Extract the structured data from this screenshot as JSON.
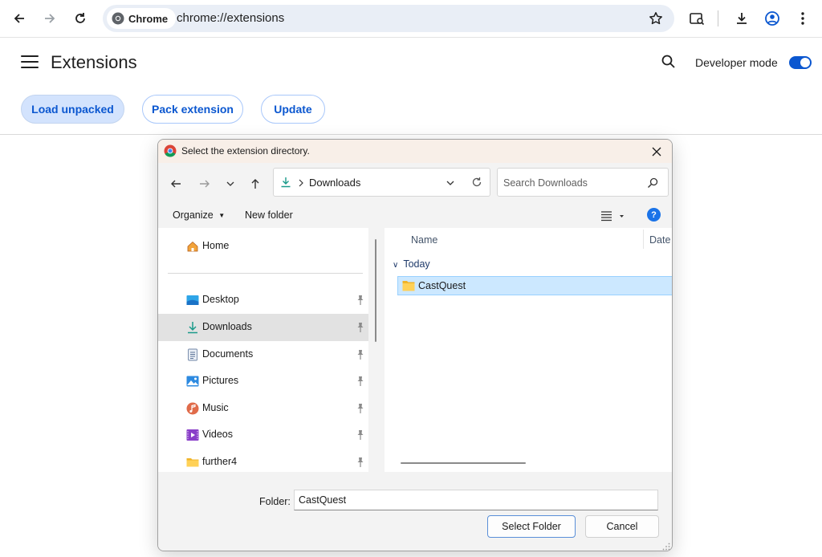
{
  "browser": {
    "omnibox_chip": "Chrome",
    "url": "chrome://extensions"
  },
  "extensions_page": {
    "title": "Extensions",
    "developer_mode_label": "Developer mode",
    "developer_mode_enabled": true,
    "buttons": {
      "load_unpacked": "Load unpacked",
      "pack_extension": "Pack extension",
      "update": "Update"
    }
  },
  "dialog": {
    "title": "Select the extension directory.",
    "address_path": "Downloads",
    "search_placeholder": "Search Downloads",
    "toolbar": {
      "organize": "Organize",
      "new_folder": "New folder"
    },
    "nav_pane": {
      "home": "Home",
      "items": [
        {
          "label": "Desktop",
          "icon": "desktop-icon"
        },
        {
          "label": "Downloads",
          "icon": "download-icon",
          "selected": true
        },
        {
          "label": "Documents",
          "icon": "documents-icon"
        },
        {
          "label": "Pictures",
          "icon": "pictures-icon"
        },
        {
          "label": "Music",
          "icon": "music-icon"
        },
        {
          "label": "Videos",
          "icon": "videos-icon"
        },
        {
          "label": "further4",
          "icon": "folder-icon"
        }
      ]
    },
    "file_list": {
      "columns": [
        "Name",
        "Date"
      ],
      "group": "Today",
      "items": [
        {
          "name": "CastQuest",
          "icon": "folder-icon",
          "selected": true
        }
      ]
    },
    "footer": {
      "folder_label": "Folder:",
      "folder_value": "CastQuest",
      "select_button": "Select Folder",
      "cancel_button": "Cancel"
    }
  },
  "colors": {
    "accent": "#0b57d0",
    "selection": "#cce8ff",
    "help_badge": "#1a73e8"
  }
}
